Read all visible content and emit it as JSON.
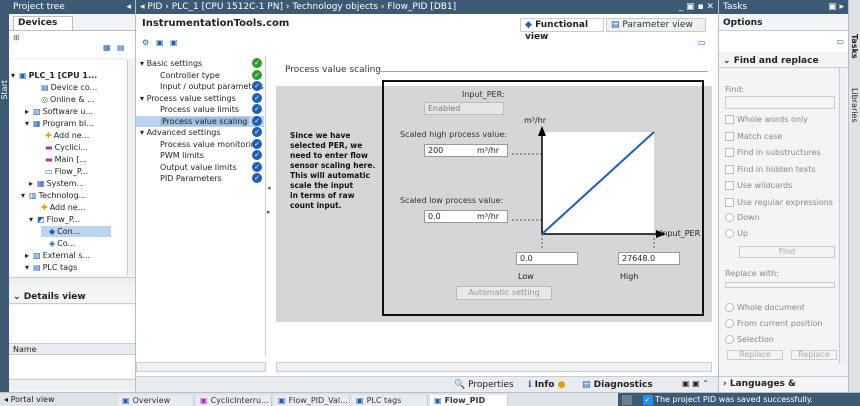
{
  "colors": {
    "header": "#3c5a74",
    "panel": "#dfe3e8",
    "accent": "#1e5fb3",
    "check_green": "#2a9d2a"
  },
  "side_labels": {
    "start": "Start",
    "tasks": "Tasks",
    "libraries": "Libraries"
  },
  "project_tree": {
    "title": "Project tree",
    "tab": "Devices",
    "items": [
      {
        "label": "PLC_1 [CPU 1...",
        "icon": "plc-icon"
      },
      {
        "label": "Device co...",
        "icon": "device-config-icon"
      },
      {
        "label": "Online & ...",
        "icon": "online-diagnostics-icon"
      },
      {
        "label": "Software u...",
        "icon": "software-units-icon"
      },
      {
        "label": "Program bl...",
        "icon": "program-blocks-icon"
      },
      {
        "label": "Add ne...",
        "icon": "add-new-block-icon"
      },
      {
        "label": "Cyclici...",
        "icon": "cyclic-interrupt-icon"
      },
      {
        "label": "Main [...",
        "icon": "main-block-icon"
      },
      {
        "label": "Flow_P...",
        "icon": "db-icon"
      },
      {
        "label": "System...",
        "icon": "system-blocks-icon"
      },
      {
        "label": "Technolog...",
        "icon": "technology-objects-icon"
      },
      {
        "label": "Add ne...",
        "icon": "add-new-object-icon"
      },
      {
        "label": "Flow_P...",
        "icon": "pid-object-icon"
      },
      {
        "label": "Con...",
        "icon": "configuration-icon"
      },
      {
        "label": "Co...",
        "icon": "commissioning-icon"
      },
      {
        "label": "External s...",
        "icon": "external-source-icon"
      },
      {
        "label": "PLC tags",
        "icon": "plc-tags-icon"
      }
    ]
  },
  "details_view": {
    "title": "Details view",
    "column_name": "Name"
  },
  "breadcrumb": {
    "p1": "PID",
    "p2": "PLC_1 [CPU 1512C-1 PN]",
    "p3": "Technology objects",
    "p4": "Flow_PID [DB1]"
  },
  "editor": {
    "site_title": "InstrumentationTools.com",
    "functional_view": "Functional view",
    "parameter_view": "Parameter view",
    "nav": [
      {
        "label": "Basic settings",
        "level": 0,
        "check": "green"
      },
      {
        "label": "Controller type",
        "level": 1,
        "check": "green"
      },
      {
        "label": "Input / output parameters",
        "level": 1,
        "check": "blue"
      },
      {
        "label": "Process value settings",
        "level": 0,
        "check": "blue"
      },
      {
        "label": "Process value limits",
        "level": 1,
        "check": "blue"
      },
      {
        "label": "Process value scaling",
        "level": 1,
        "check": "blue",
        "selected": true
      },
      {
        "label": "Advanced settings",
        "level": 0,
        "check": "blue"
      },
      {
        "label": "Process value monitoring",
        "level": 1,
        "check": "blue"
      },
      {
        "label": "PWM limits",
        "level": 1,
        "check": "blue"
      },
      {
        "label": "Output value limits",
        "level": 1,
        "check": "blue"
      },
      {
        "label": "PID Parameters",
        "level": 1,
        "check": "blue"
      }
    ],
    "section_title": "Process value scaling",
    "annotation_lines": [
      "Since we have",
      "selected PER, we",
      "need to enter flow",
      "sensor scaling here.",
      "This will automatic",
      "scale the input",
      "in terms of raw",
      "count input."
    ],
    "input_per_label": "Input_PER:",
    "input_per_value": "Enabled",
    "scaled_high_label": "Scaled high process value:",
    "scaled_high_value": "200",
    "scaled_high_unit": "m³/hr",
    "scaled_low_label": "Scaled low process value:",
    "scaled_low_value": "0.0",
    "scaled_low_unit": "m³/hr",
    "graph_y_unit": "m³/hr",
    "graph_x_label": "Input_PER",
    "low_value": "0.0",
    "high_value": "27648.0",
    "low_label": "Low",
    "high_label": "High",
    "auto_setting": "Automatic setting"
  },
  "bottom_tabs": {
    "properties": "Properties",
    "info": "Info",
    "diagnostics": "Diagnostics"
  },
  "tasks": {
    "title": "Tasks",
    "options_title": "Options",
    "find_replace_title": "Find and replace",
    "find_label": "Find:",
    "checkboxes": [
      "Whole words only",
      "Match case",
      "Find in substructures",
      "Find in hidden texts",
      "Use wildcards",
      "Use regular expressions"
    ],
    "direction": [
      "Down",
      "Up"
    ],
    "find_button": "Find",
    "replace_with": "Replace with:",
    "scope": [
      "Whole document",
      "From current position",
      "Selection"
    ],
    "replace_button": "Replace",
    "replace_all_button": "Replace",
    "languages_title": "Languages & resources"
  },
  "taskbar": {
    "portal_view": "Portal view",
    "items": [
      "Overview",
      "CyclicInterru...",
      "Flow_PID_Val...",
      "PLC tags",
      "Flow_PID"
    ],
    "status": "The project PID was saved successfully."
  }
}
